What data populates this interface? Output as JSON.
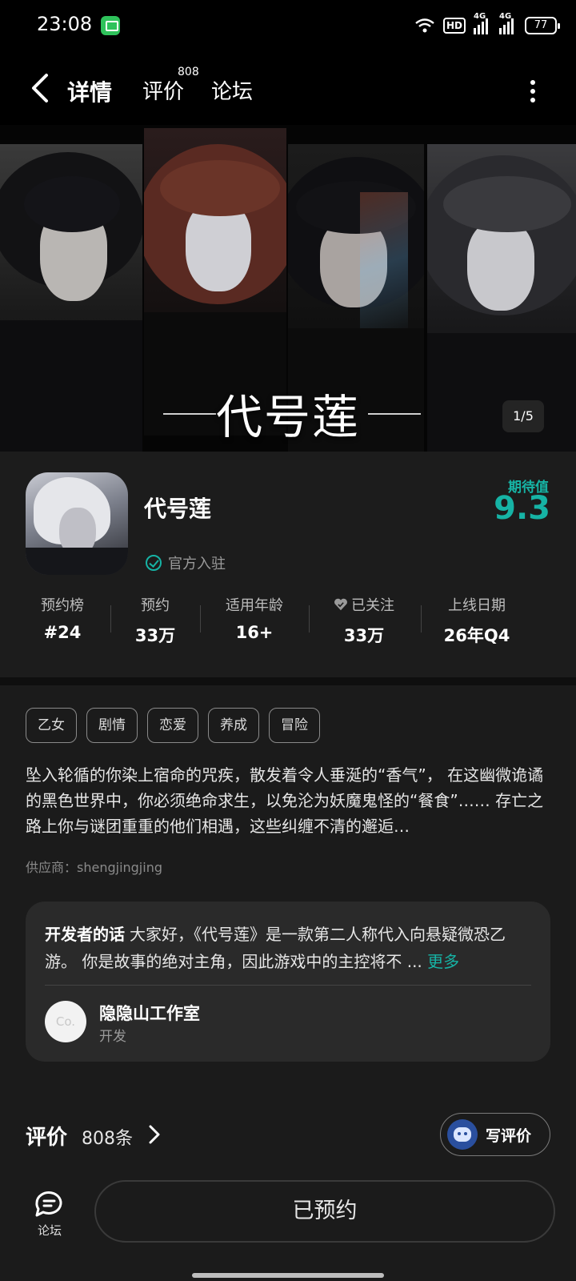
{
  "status": {
    "time": "23:08",
    "hd_label": "HD",
    "net1": "4G",
    "net2": "4G",
    "battery": "77"
  },
  "nav": {
    "tabs": [
      {
        "label": "详情",
        "active": true
      },
      {
        "label": "评价",
        "badge": "808"
      },
      {
        "label": "论坛"
      }
    ]
  },
  "banner": {
    "title": "代号莲",
    "pager": "1/5"
  },
  "app": {
    "name": "代号莲",
    "official": "官方入驻",
    "expect_label": "期待值",
    "expect_value": "9.3",
    "stats": [
      {
        "label": "预约榜",
        "value": "#24"
      },
      {
        "label": "预约",
        "value": "33万"
      },
      {
        "label": "适用年龄",
        "value": "16+"
      },
      {
        "label": "已关注",
        "value": "33万",
        "icon": "heart-icon"
      },
      {
        "label": "上线日期",
        "value": "26年Q4"
      }
    ]
  },
  "tags": [
    "乙女",
    "剧情",
    "恋爱",
    "养成",
    "冒险"
  ],
  "description": "坠入轮循的你染上宿命的咒疾，散发着令人垂涎的“香气”， 在这幽微诡谲的黑色世界中，你必须绝命求生，以免沦为妖魔鬼怪的“餐食”…… 存亡之路上你与谜团重重的他们相遇，这些纠缠不清的邂逅…",
  "supplier": "供应商：shengjingjing",
  "developer": {
    "heading": "开发者的话",
    "text": "大家好，《代号莲》是一款第二人称代入向悬疑微恐乙游。 你是故事的绝对主角，因此游戏中的主控将不 ...",
    "more": "更多",
    "avatar_text": "Co.",
    "name": "隐隐山工作室",
    "role": "开发"
  },
  "reviews": {
    "title": "评价",
    "count": "808条",
    "write_label": "写评价"
  },
  "bottom": {
    "forum_label": "论坛",
    "reserve_label": "已预约"
  },
  "colors": {
    "accent": "#16b3a5",
    "background": "#1b1b1b",
    "card": "#2a2a2a"
  }
}
